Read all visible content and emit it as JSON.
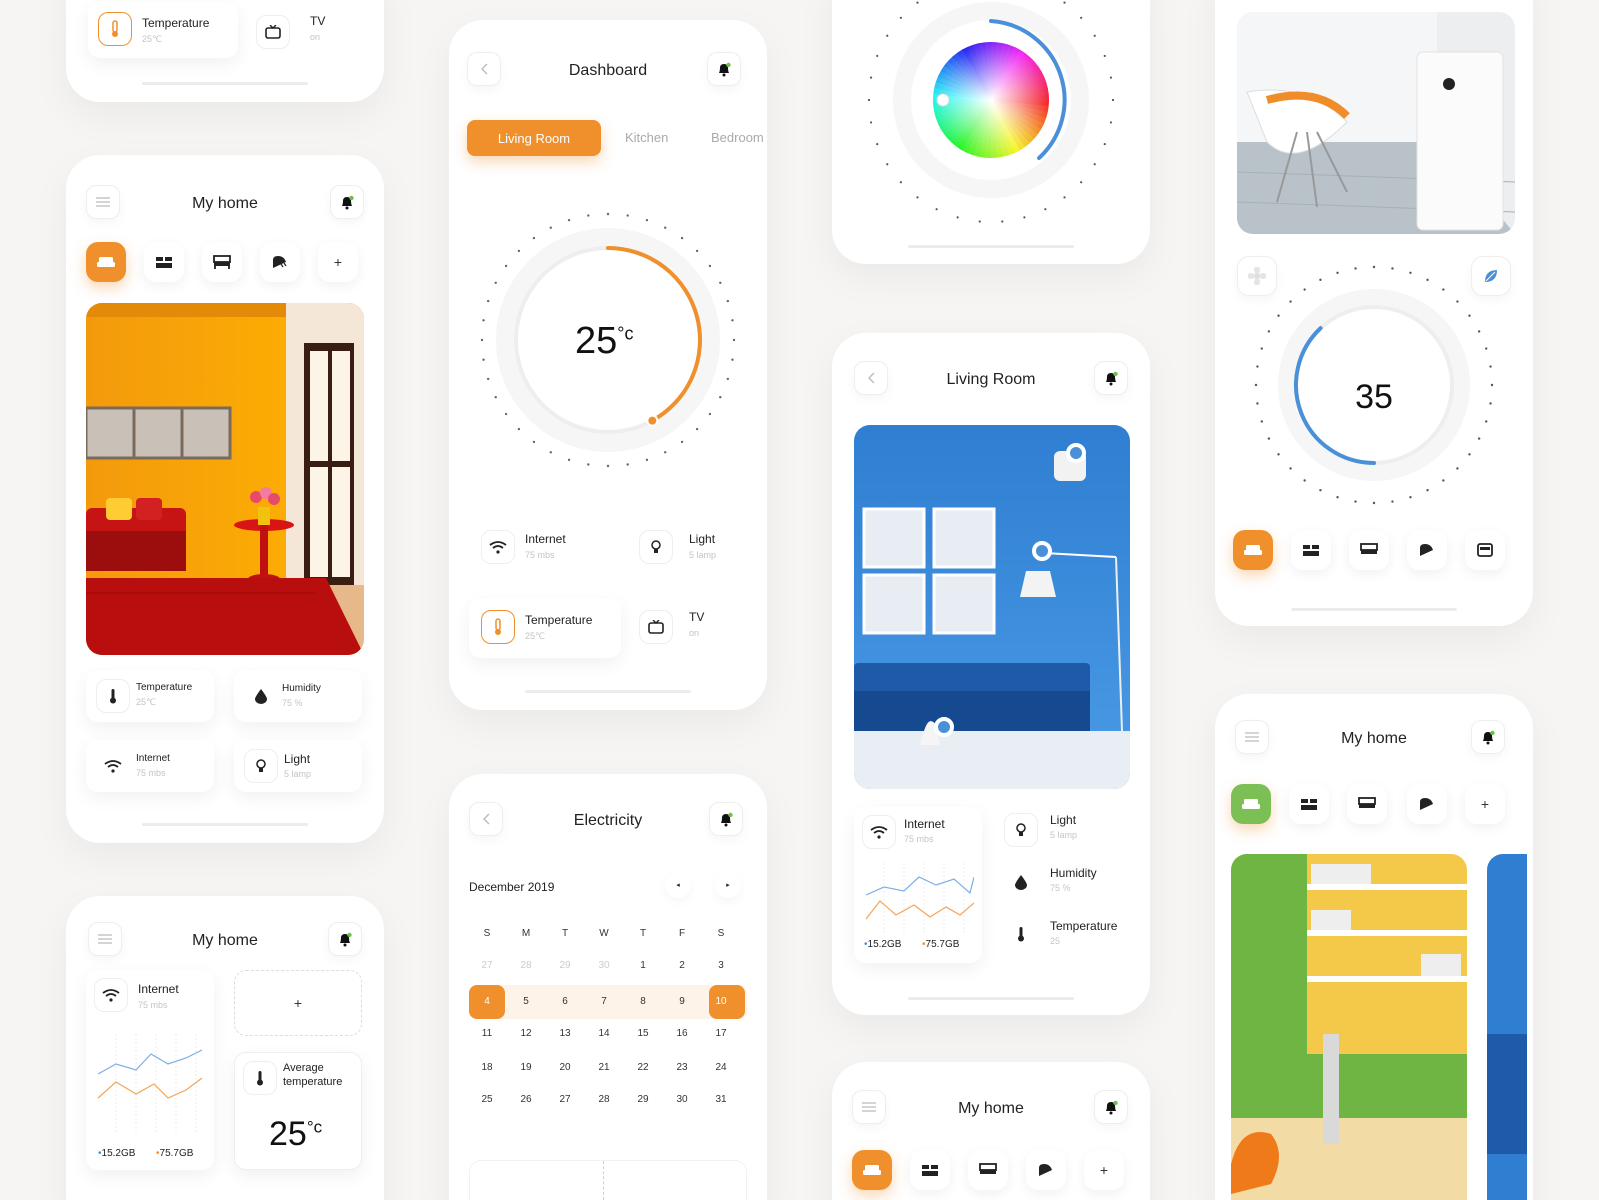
{
  "card1": {
    "temp_label": "Temperature",
    "temp_value": "25℃",
    "tv_label": "TV",
    "tv_value": "on"
  },
  "card_myhome1": {
    "title": "My home",
    "tiles": [
      {
        "label": "Temperature",
        "value": "25℃"
      },
      {
        "label": "Humidity",
        "value": "75 %"
      },
      {
        "label": "Internet",
        "value": "75 mbs"
      },
      {
        "label": "Light",
        "value": "5 lamp"
      }
    ]
  },
  "card_myhome2": {
    "title": "My home",
    "internet_label": "Internet",
    "internet_value": "75 mbs",
    "legend1": "15.2GB",
    "legend2": "75.7GB",
    "add_label": "+",
    "avg_label": "Average temperature",
    "avg_value": "25",
    "avg_unit": "°c"
  },
  "dashboard": {
    "title": "Dashboard",
    "tabs": [
      "Living Room",
      "Kitchen",
      "Bedroom"
    ],
    "temp_value": "25",
    "temp_unit": "°c",
    "temp_level": 0.42,
    "devices": [
      {
        "label": "Internet",
        "value": "75 mbs"
      },
      {
        "label": "Light",
        "value": "5 lamp"
      },
      {
        "label": "Temperature",
        "value": "25℃"
      },
      {
        "label": "TV",
        "value": "on"
      }
    ]
  },
  "electricity": {
    "title": "Electricity",
    "month": "December 2019",
    "weekdays": [
      "S",
      "M",
      "T",
      "W",
      "T",
      "F",
      "S"
    ],
    "weeks": [
      [
        "27",
        "28",
        "29",
        "30",
        "1",
        "2",
        "3"
      ],
      [
        "4",
        "5",
        "6",
        "7",
        "8",
        "9",
        "10"
      ],
      [
        "11",
        "12",
        "13",
        "14",
        "15",
        "16",
        "17"
      ],
      [
        "18",
        "19",
        "20",
        "21",
        "22",
        "23",
        "24"
      ],
      [
        "25",
        "26",
        "27",
        "28",
        "29",
        "30",
        "31"
      ]
    ],
    "range_start": "4",
    "range_end": "10"
  },
  "living_room": {
    "title": "Living Room",
    "internet_label": "Internet",
    "internet_value": "75 mbs",
    "legend1": "15.2GB",
    "legend2": "75.7GB",
    "items": [
      {
        "label": "Light",
        "value": "5 lamp"
      },
      {
        "label": "Humidity",
        "value": "75 %"
      },
      {
        "label": "Temperature",
        "value": "25"
      }
    ]
  },
  "myhome_bottom": {
    "title": "My home",
    "add_label": "+"
  },
  "purifier": {
    "value": "35",
    "level": 0.38
  },
  "myhome_right": {
    "title": "My home",
    "add_label": "+"
  },
  "colors": {
    "accent": "#f0902d",
    "blue": "#4a90d9",
    "green": "#7cbf55"
  }
}
